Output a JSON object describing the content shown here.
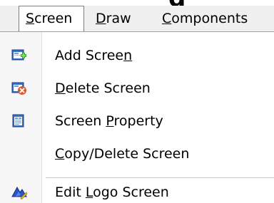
{
  "menubar": {
    "tabs": [
      {
        "label_parts": [
          "",
          "S",
          "creen"
        ],
        "active": true
      },
      {
        "label_parts": [
          "",
          "D",
          "raw"
        ],
        "active": false
      },
      {
        "label_parts": [
          "",
          "C",
          "omponents"
        ],
        "active": false
      }
    ]
  },
  "top_cut_text": "g",
  "dropdown": {
    "items": [
      {
        "label_parts": [
          "Add Scree",
          "n",
          ""
        ],
        "icon": "add-screen-icon"
      },
      {
        "label_parts": [
          "",
          "D",
          "elete Screen"
        ],
        "icon": "delete-screen-icon"
      },
      {
        "label_parts": [
          "Screen ",
          "P",
          "roperty"
        ],
        "icon": "screen-property-icon"
      },
      {
        "label_parts": [
          "",
          "C",
          "opy/Delete Screen"
        ],
        "icon": ""
      },
      {
        "label_parts": [
          "Edit ",
          "L",
          "ogo Screen"
        ],
        "icon": "edit-logo-screen-icon"
      }
    ]
  },
  "colors": {
    "menubar_bg": "#f0f0f0",
    "gutter_bg": "#f7f7f7",
    "separator": "#c8c8c8"
  }
}
